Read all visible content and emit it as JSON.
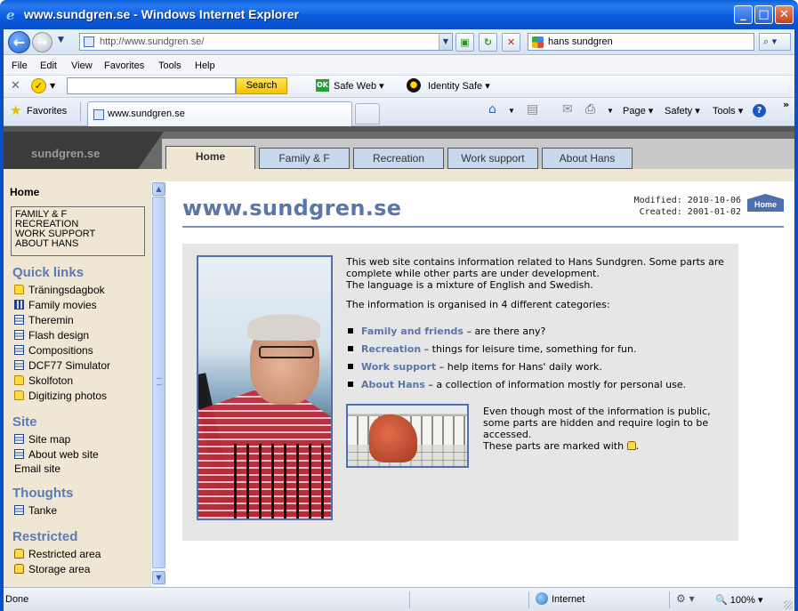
{
  "window": {
    "title": "www.sundgren.se - Windows Internet Explorer"
  },
  "nav": {
    "url": "http://www.sundgren.se/",
    "search_value": "hans sundgren"
  },
  "menu": [
    "File",
    "Edit",
    "View",
    "Favorites",
    "Tools",
    "Help"
  ],
  "norton": {
    "search_label": "Search",
    "safe_web": "Safe Web ▾",
    "identity_safe": "Identity Safe ▾",
    "ok_badge": "OK"
  },
  "favbar": {
    "favorites_label": "Favorites",
    "tab_title": "www.sundgren.se"
  },
  "commands": {
    "page": "Page ▾",
    "safety": "Safety ▾",
    "tools": "Tools ▾",
    "help": "?"
  },
  "site": {
    "logo": "sundgren.se",
    "tabs": [
      "Home",
      "Family & F",
      "Recreation",
      "Work support",
      "About Hans"
    ],
    "active_tab": "Home"
  },
  "sidebar": {
    "home": "Home",
    "top_links": [
      "FAMILY & F",
      "RECREATION",
      "WORK SUPPORT",
      "ABOUT HANS"
    ],
    "sections": [
      {
        "heading": "Quick links",
        "items": [
          {
            "label": "Träningsdagbok",
            "icon": "folder-icon"
          },
          {
            "label": "Family movies",
            "icon": "film-icon"
          },
          {
            "label": "Theremin",
            "icon": "document-icon"
          },
          {
            "label": "Flash design",
            "icon": "document-icon"
          },
          {
            "label": "Compositions",
            "icon": "document-icon"
          },
          {
            "label": "DCF77 Simulator",
            "icon": "document-icon"
          },
          {
            "label": "Skolfoton",
            "icon": "folder-icon"
          },
          {
            "label": "Digitizing photos",
            "icon": "folder-icon"
          }
        ]
      },
      {
        "heading": "Site",
        "items": [
          {
            "label": "Site map",
            "icon": "document-icon"
          },
          {
            "label": "About web site",
            "icon": "document-icon"
          },
          {
            "label": "Email site",
            "icon": ""
          }
        ]
      },
      {
        "heading": "Thoughts",
        "items": [
          {
            "label": "Tanke",
            "icon": "document-icon"
          }
        ]
      },
      {
        "heading": "Restricted",
        "items": [
          {
            "label": "Restricted area",
            "icon": "lock-icon"
          },
          {
            "label": "Storage area",
            "icon": "lock-icon"
          }
        ]
      }
    ]
  },
  "main": {
    "title": "www.sundgren.se",
    "modified": "Modified: 2010-10-06",
    "created": "Created: 2001-01-02",
    "home_badge": "Home",
    "intro": [
      "This web site contains information related to Hans Sundgren. Some parts are complete while other parts are under development.",
      "The language is a mixture of English and Swedish."
    ],
    "organised": "The information is organised in 4 different categories:",
    "categories": [
      {
        "name": "Family and friends",
        "desc": " – are there any?"
      },
      {
        "name": "Recreation",
        "desc": " – things for leisure time, something for fun."
      },
      {
        "name": "Work support",
        "desc": " – help items for Hans' daily work."
      },
      {
        "name": "About Hans",
        "desc": " – a collection of information mostly for personal use."
      }
    ],
    "note": "Even though most of the information is public, some parts are hidden and require login to be accessed.",
    "note_marked": "These parts are marked with"
  },
  "status": {
    "left": "Done",
    "zone": "Internet",
    "zoom": "100%"
  }
}
